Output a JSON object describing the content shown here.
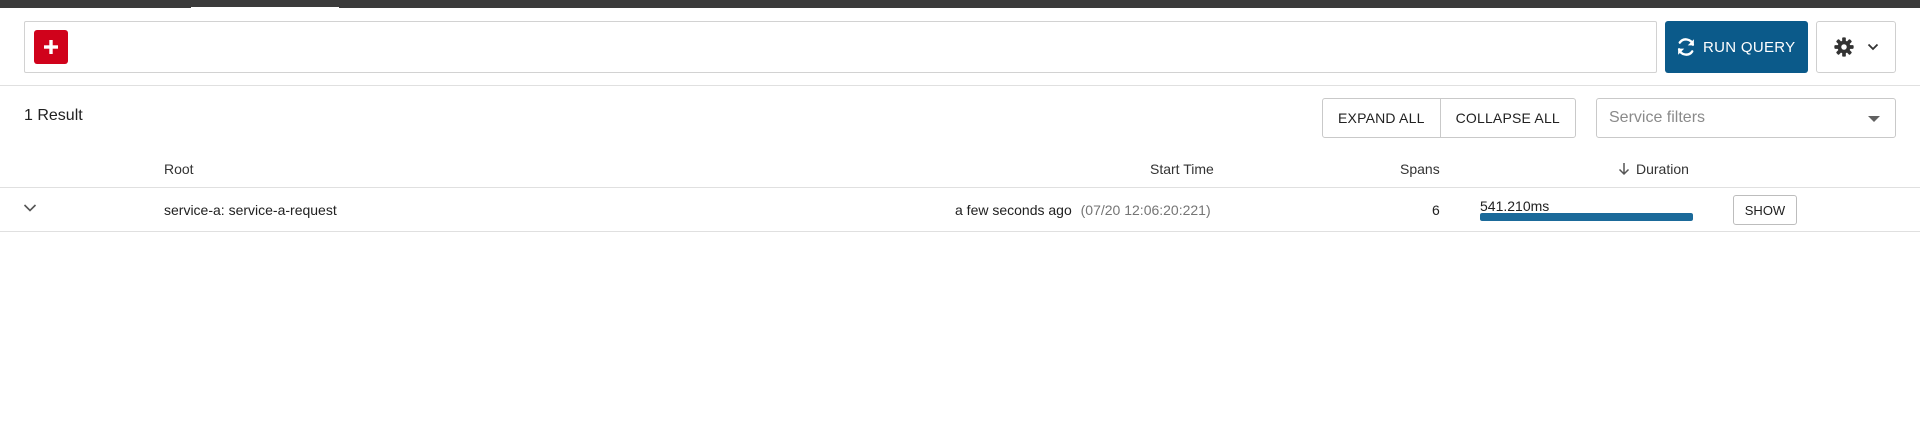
{
  "toolbar": {
    "add_icon": "plus-icon",
    "run_query_label": "RUN QUERY",
    "run_query_icon": "refresh-icon",
    "settings_icon": "gear-icon",
    "settings_caret_icon": "chevron-down-icon",
    "run_query_color": "#0b5a8a",
    "add_color": "#d0021b"
  },
  "results": {
    "count_label": "1 Result",
    "expand_all_label": "EXPAND ALL",
    "collapse_all_label": "COLLAPSE ALL",
    "service_filter_placeholder": "Service filters"
  },
  "table": {
    "headers": {
      "root": "Root",
      "start_time": "Start Time",
      "spans": "Spans",
      "duration": "Duration"
    },
    "sort_icon": "arrow-down-icon",
    "rows": [
      {
        "root": "service-a: service-a-request",
        "start_relative": "a few seconds ago",
        "start_absolute": "(07/20 12:06:20:221)",
        "spans": "6",
        "duration": "541.210ms",
        "duration_fraction": 1.0,
        "show_label": "SHOW",
        "bar_color": "#1b6a9a"
      }
    ]
  }
}
